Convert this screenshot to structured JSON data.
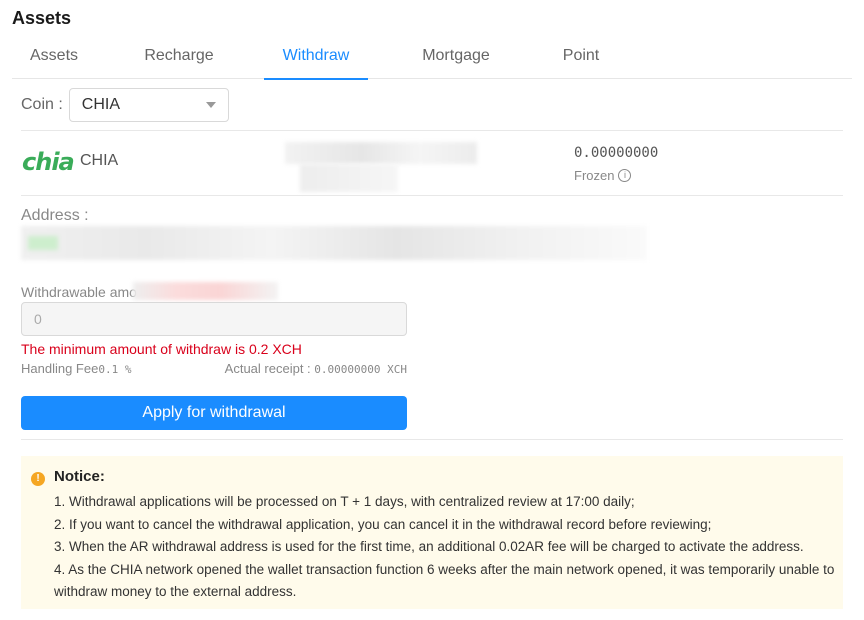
{
  "page": {
    "title": "Assets"
  },
  "tabs": [
    {
      "label": "Assets"
    },
    {
      "label": "Recharge"
    },
    {
      "label": "Withdraw"
    },
    {
      "label": "Mortgage"
    },
    {
      "label": "Point"
    }
  ],
  "active_tab": "Withdraw",
  "coin": {
    "label": "Coin :",
    "selected": "CHIA"
  },
  "asset": {
    "logo_text": "chia",
    "name": "CHIA",
    "balance": "0.00000000",
    "frozen_label": "Frozen"
  },
  "address": {
    "label": "Address :"
  },
  "withdraw": {
    "withdrawable_label": "Withdrawable amo",
    "amount_placeholder": "0",
    "error": "The minimum amount of withdraw is 0.2 XCH",
    "fee_label": "Handling Fee",
    "fee_value": "0.1 %",
    "receipt_label": "Actual receipt : ",
    "receipt_value": "0.00000000 XCH",
    "apply_label": "Apply for withdrawal"
  },
  "notice": {
    "title": "Notice:",
    "items": [
      "1. Withdrawal applications will be processed on T + 1 days, with centralized review at 17:00 daily;",
      "2. If you want to cancel the withdrawal application, you can cancel it in the withdrawal record before reviewing;",
      "3. When the AR withdrawal address is used for the first time, an additional 0.02AR fee will be charged to activate the address.",
      "4. As the CHIA network opened the wallet transaction function 6 weeks after the main network opened, it was temporarily unable to withdraw money to the external address."
    ]
  },
  "colors": {
    "accent": "#1a8cff",
    "error": "#d9001b",
    "chia_green": "#3aac59",
    "notice_bg": "#fffbeb",
    "notice_icon": "#f5a623"
  }
}
